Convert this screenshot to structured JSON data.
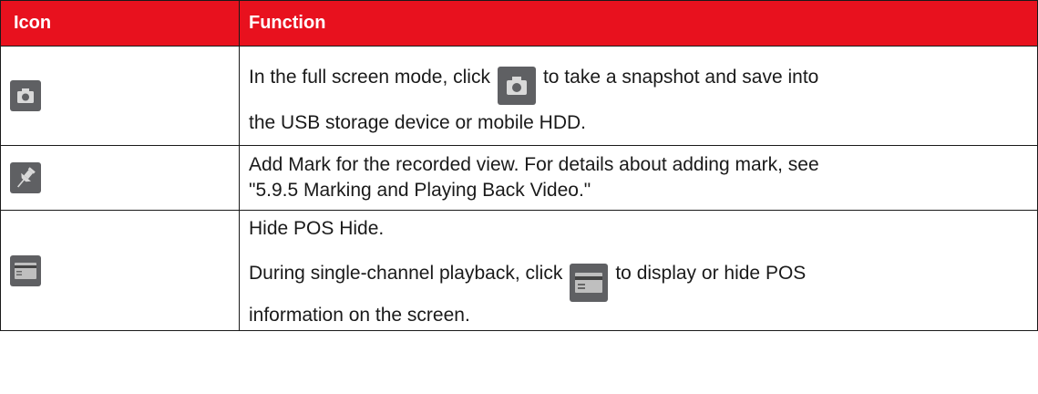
{
  "table": {
    "headers": [
      "Icon",
      "Function"
    ],
    "rows": [
      {
        "icon": "camera-icon",
        "text": {
          "before": "In the full screen mode, click",
          "after": "to take a snapshot and save into",
          "line2": "the USB storage device or mobile HDD."
        }
      },
      {
        "icon": "pin-icon",
        "text": {
          "line1": "Add Mark for the recorded view. For details about adding mark, see",
          "line2": "\"5.9.5 Marking and Playing Back Video.\""
        }
      },
      {
        "icon": "pos-card-icon",
        "text": {
          "line1": "Hide POS Hide.",
          "before": "During single-channel playback, click",
          "after": "to display or hide POS",
          "line3": "information on the screen."
        }
      }
    ]
  },
  "colors": {
    "header_bg": "#e8111e",
    "header_text": "#ffffff",
    "icon_bg": "#5f6063"
  }
}
